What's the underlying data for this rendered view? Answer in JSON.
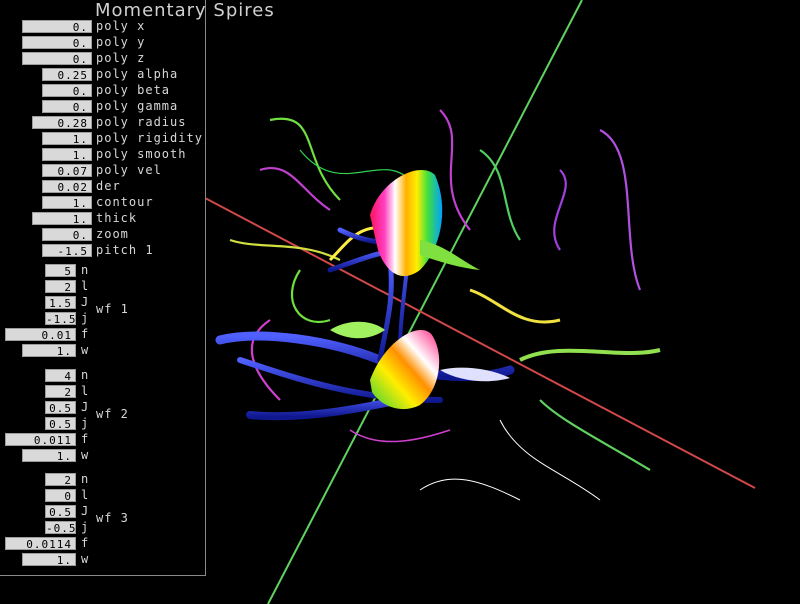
{
  "app": {
    "title": "Momentary Spires"
  },
  "poly_params": [
    {
      "value": "0.",
      "label": "poly x"
    },
    {
      "value": "0.",
      "label": "poly y"
    },
    {
      "value": "0.",
      "label": "poly z"
    },
    {
      "value": "0.25",
      "label": "poly alpha"
    },
    {
      "value": "0.",
      "label": "poly beta"
    },
    {
      "value": "0.",
      "label": "poly gamma"
    },
    {
      "value": "0.28",
      "label": "poly radius"
    },
    {
      "value": "1.",
      "label": "poly rigidity"
    },
    {
      "value": "1.",
      "label": "poly smooth"
    },
    {
      "value": "0.07",
      "label": "poly vel"
    },
    {
      "value": "0.02",
      "label": "der"
    },
    {
      "value": "1.",
      "label": "contour"
    },
    {
      "value": "1.",
      "label": "thick"
    },
    {
      "value": "0.",
      "label": "zoom"
    },
    {
      "value": "-1.5",
      "label": "pitch 1"
    }
  ],
  "wavefunctions": [
    {
      "name": "wf 1",
      "params": [
        {
          "value": "5",
          "label": "n"
        },
        {
          "value": "2",
          "label": "l"
        },
        {
          "value": "1.5",
          "label": "J"
        },
        {
          "value": "-1.5",
          "label": "j"
        },
        {
          "value": "0.01",
          "label": "f"
        },
        {
          "value": "1.",
          "label": "w"
        }
      ]
    },
    {
      "name": "wf 2",
      "params": [
        {
          "value": "4",
          "label": "n"
        },
        {
          "value": "2",
          "label": "l"
        },
        {
          "value": "0.5",
          "label": "J"
        },
        {
          "value": "0.5",
          "label": "j"
        },
        {
          "value": "0.011",
          "label": "f"
        },
        {
          "value": "1.",
          "label": "w"
        }
      ]
    },
    {
      "name": "wf 3",
      "params": [
        {
          "value": "2",
          "label": "n"
        },
        {
          "value": "0",
          "label": "l"
        },
        {
          "value": "0.5",
          "label": "J"
        },
        {
          "value": "-0.5",
          "label": "j"
        },
        {
          "value": "0.0114",
          "label": "f"
        },
        {
          "value": "1.",
          "label": "w"
        }
      ]
    }
  ],
  "colors": {
    "axis_green": "#5fd35f",
    "axis_red": "#d04848",
    "field_bg": "#d9d9d9",
    "panel_border": "#8a8a8a"
  }
}
